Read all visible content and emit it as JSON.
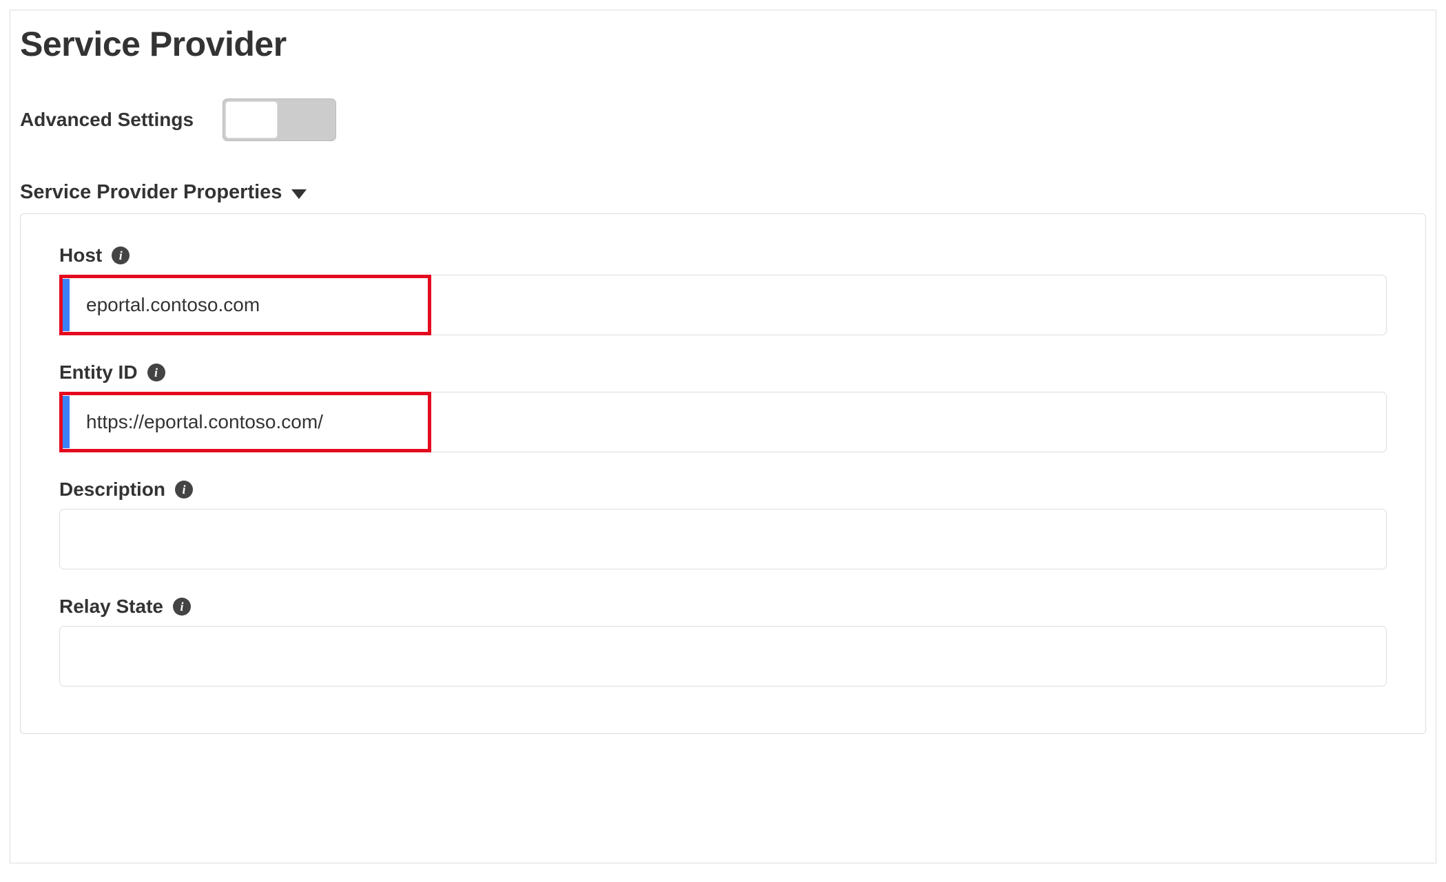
{
  "page": {
    "title": "Service Provider",
    "advanced_settings_label": "Advanced Settings",
    "section_title": "Service Provider Properties"
  },
  "fields": {
    "host": {
      "label": "Host",
      "value": "eportal.contoso.com"
    },
    "entity_id": {
      "label": "Entity ID",
      "value": "https://eportal.contoso.com/"
    },
    "description": {
      "label": "Description",
      "value": ""
    },
    "relay_state": {
      "label": "Relay State",
      "value": ""
    }
  }
}
